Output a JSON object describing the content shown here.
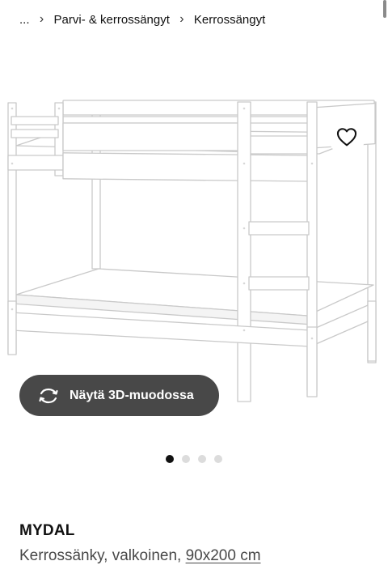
{
  "breadcrumb": {
    "ellipsis": "...",
    "items": [
      {
        "label": "Parvi- & kerrossängyt"
      },
      {
        "label": "Kerrossängyt"
      }
    ]
  },
  "gallery": {
    "image_alt": "MYDAL kerrossänky, valkoinen",
    "favourite_icon": "heart-icon",
    "view_3d": {
      "label": "Näytä 3D-muodossa",
      "icon": "rotate-3d-icon"
    },
    "pagination": {
      "count": 4,
      "active_index": 0
    }
  },
  "product": {
    "name": "MYDAL",
    "description_prefix": "Kerrossänky, valkoinen, ",
    "size": "90x200 cm"
  },
  "colors": {
    "accent_dark": "#484848",
    "text": "#111111",
    "dot_inactive": "#dcdcdc"
  }
}
